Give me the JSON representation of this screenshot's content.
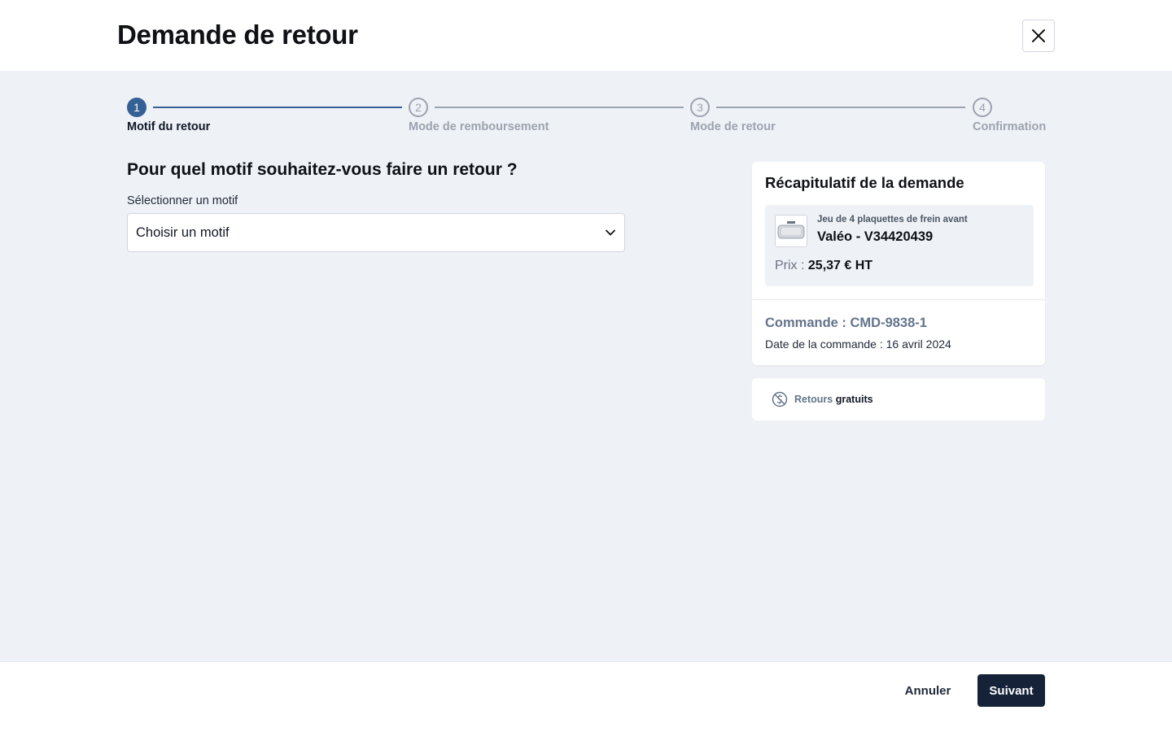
{
  "header": {
    "title": "Demande de retour"
  },
  "stepper": {
    "steps": [
      {
        "number": "1",
        "label": "Motif du retour",
        "state": "active"
      },
      {
        "number": "2",
        "label": "Mode de remboursement",
        "state": "inactive"
      },
      {
        "number": "3",
        "label": "Mode de retour",
        "state": "inactive"
      },
      {
        "number": "4",
        "label": "Confirmation",
        "state": "inactive"
      }
    ]
  },
  "form": {
    "question": "Pour quel motif souhaitez-vous faire un retour ?",
    "select_label": "Sélectionner un motif",
    "select_value": "Choisir un motif"
  },
  "summary": {
    "title": "Récapitulatif de la demande",
    "product": {
      "description": "Jeu de 4 plaquettes de frein avant",
      "name": "Valéo - V34420439",
      "price_label": "Prix :",
      "price_value": "25,37 € HT"
    },
    "order": {
      "id": "Commande : CMD-9838-1",
      "date": "Date de la commande : 16 avril 2024"
    }
  },
  "returns_info": {
    "muted": "Retours",
    "strong": "gratuits"
  },
  "footer": {
    "cancel_label": "Annuler",
    "next_label": "Suivant"
  },
  "colors": {
    "accent": "#356096",
    "primary_button": "#152238",
    "background": "#eef2f7"
  }
}
